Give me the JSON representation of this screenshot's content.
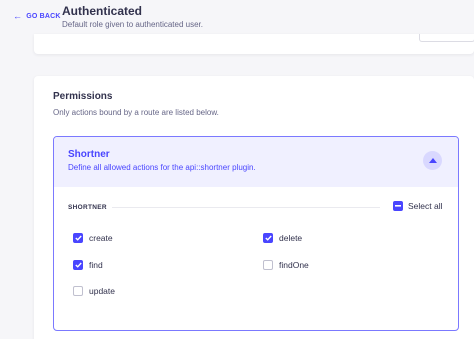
{
  "header": {
    "back_label": "GO BACK",
    "title": "Authenticated",
    "subtitle": "Default role given to authenticated user."
  },
  "permissions": {
    "title": "Permissions",
    "description": "Only actions bound by a route are listed below."
  },
  "accordion": {
    "title": "Shortner",
    "description": "Define all allowed actions for the api::shortner plugin.",
    "expanded": true,
    "section_label": "SHORTNER",
    "select_all_label": "Select all",
    "select_all_state": "indeterminate",
    "actions": [
      {
        "label": "create",
        "checked": true
      },
      {
        "label": "delete",
        "checked": true
      },
      {
        "label": "find",
        "checked": true
      },
      {
        "label": "findOne",
        "checked": false
      },
      {
        "label": "update",
        "checked": false
      }
    ]
  },
  "colors": {
    "primary": "#4945ff",
    "primary_light": "#f0f0ff",
    "border_accent": "#7b79ff",
    "text": "#32324d",
    "muted": "#666687",
    "background": "#f6f6f9"
  }
}
